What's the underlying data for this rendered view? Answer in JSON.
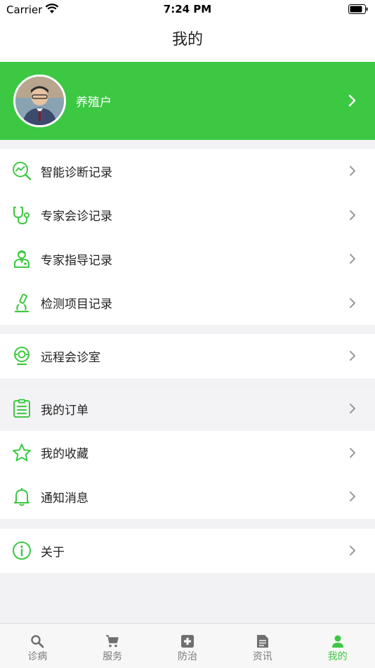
{
  "status_bar": {
    "carrier": "Carrier",
    "time": "7:24 PM"
  },
  "nav": {
    "title": "我的"
  },
  "profile": {
    "username": "养殖户"
  },
  "menu": {
    "records": [
      {
        "label": "智能诊断记录",
        "icon": "diagnosis-chart-icon"
      },
      {
        "label": "专家会诊记录",
        "icon": "stethoscope-icon"
      },
      {
        "label": "专家指导记录",
        "icon": "doctor-icon"
      },
      {
        "label": "检测项目记录",
        "icon": "microscope-icon"
      }
    ],
    "remote": {
      "label": "远程会诊室",
      "icon": "webcam-icon"
    },
    "personal": [
      {
        "label": "我的订单",
        "icon": "clipboard-icon"
      },
      {
        "label": "我的收藏",
        "icon": "star-icon"
      },
      {
        "label": "通知消息",
        "icon": "bell-icon"
      }
    ],
    "about": {
      "label": "关于",
      "icon": "info-icon"
    }
  },
  "tabs": [
    {
      "label": "诊病",
      "icon": "search-icon"
    },
    {
      "label": "服务",
      "icon": "cart-icon"
    },
    {
      "label": "防治",
      "icon": "medical-cross-icon"
    },
    {
      "label": "资讯",
      "icon": "document-icon"
    },
    {
      "label": "我的",
      "icon": "person-icon",
      "active": true
    }
  ],
  "colors": {
    "accent": "#3dc843",
    "tab_inactive": "#7a7a7a",
    "background": "#f2f2f4"
  }
}
